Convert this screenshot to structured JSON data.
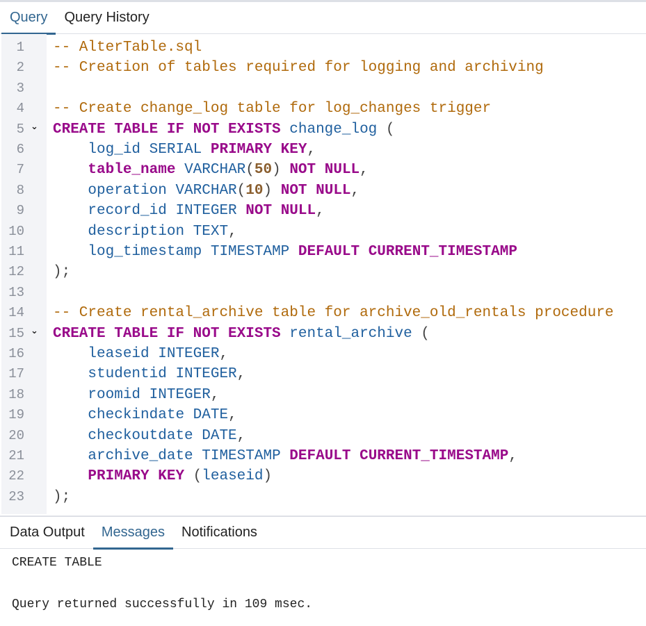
{
  "top_tabs": [
    {
      "label": "Query",
      "active": true
    },
    {
      "label": "Query History",
      "active": false
    }
  ],
  "editor": {
    "fold_lines": [
      5,
      15
    ],
    "lines": [
      [
        [
          "c",
          "-- AlterTable.sql"
        ]
      ],
      [
        [
          "c",
          "-- Creation of tables required for logging and archiving"
        ]
      ],
      [],
      [
        [
          "c",
          "-- Create change_log table for log_changes trigger"
        ]
      ],
      [
        [
          "k",
          "CREATE TABLE IF NOT EXISTS"
        ],
        [
          "p",
          " "
        ],
        [
          "i",
          "change_log"
        ],
        [
          "p",
          " ("
        ]
      ],
      [
        [
          "p",
          "    "
        ],
        [
          "i",
          "log_id SERIAL"
        ],
        [
          "p",
          " "
        ],
        [
          "k",
          "PRIMARY KEY"
        ],
        [
          "p",
          ","
        ]
      ],
      [
        [
          "p",
          "    "
        ],
        [
          "b",
          "table_name"
        ],
        [
          "p",
          " "
        ],
        [
          "i",
          "VARCHAR"
        ],
        [
          "p",
          "("
        ],
        [
          "n",
          "50"
        ],
        [
          "p",
          ") "
        ],
        [
          "k",
          "NOT NULL"
        ],
        [
          "p",
          ","
        ]
      ],
      [
        [
          "p",
          "    "
        ],
        [
          "i",
          "operation VARCHAR"
        ],
        [
          "p",
          "("
        ],
        [
          "n",
          "10"
        ],
        [
          "p",
          ") "
        ],
        [
          "k",
          "NOT NULL"
        ],
        [
          "p",
          ","
        ]
      ],
      [
        [
          "p",
          "    "
        ],
        [
          "i",
          "record_id INTEGER"
        ],
        [
          "p",
          " "
        ],
        [
          "k",
          "NOT NULL"
        ],
        [
          "p",
          ","
        ]
      ],
      [
        [
          "p",
          "    "
        ],
        [
          "i",
          "description TEXT"
        ],
        [
          "p",
          ","
        ]
      ],
      [
        [
          "p",
          "    "
        ],
        [
          "i",
          "log_timestamp TIMESTAMP"
        ],
        [
          "p",
          " "
        ],
        [
          "k",
          "DEFAULT CURRENT_TIMESTAMP"
        ]
      ],
      [
        [
          "p",
          ");"
        ]
      ],
      [],
      [
        [
          "c",
          "-- Create rental_archive table for archive_old_rentals procedure"
        ]
      ],
      [
        [
          "k",
          "CREATE TABLE IF NOT EXISTS"
        ],
        [
          "p",
          " "
        ],
        [
          "i",
          "rental_archive"
        ],
        [
          "p",
          " ("
        ]
      ],
      [
        [
          "p",
          "    "
        ],
        [
          "i",
          "leaseid INTEGER"
        ],
        [
          "p",
          ","
        ]
      ],
      [
        [
          "p",
          "    "
        ],
        [
          "i",
          "studentid INTEGER"
        ],
        [
          "p",
          ","
        ]
      ],
      [
        [
          "p",
          "    "
        ],
        [
          "i",
          "roomid INTEGER"
        ],
        [
          "p",
          ","
        ]
      ],
      [
        [
          "p",
          "    "
        ],
        [
          "i",
          "checkindate DATE"
        ],
        [
          "p",
          ","
        ]
      ],
      [
        [
          "p",
          "    "
        ],
        [
          "i",
          "checkoutdate DATE"
        ],
        [
          "p",
          ","
        ]
      ],
      [
        [
          "p",
          "    "
        ],
        [
          "i",
          "archive_date TIMESTAMP"
        ],
        [
          "p",
          " "
        ],
        [
          "k",
          "DEFAULT CURRENT_TIMESTAMP"
        ],
        [
          "p",
          ","
        ]
      ],
      [
        [
          "p",
          "    "
        ],
        [
          "k",
          "PRIMARY KEY"
        ],
        [
          "p",
          " ("
        ],
        [
          "i",
          "leaseid"
        ],
        [
          "p",
          ")"
        ]
      ],
      [
        [
          "p",
          ");"
        ]
      ]
    ]
  },
  "bottom_tabs": [
    {
      "label": "Data Output",
      "active": false
    },
    {
      "label": "Messages",
      "active": true
    },
    {
      "label": "Notifications",
      "active": false
    }
  ],
  "messages": [
    "CREATE TABLE",
    "Query returned successfully in 109 msec."
  ],
  "colors": {
    "accent": "#326690",
    "comment": "#b06a0c",
    "keyword": "#990a8a",
    "identifier": "#1f5f9e",
    "number": "#8a5e2e"
  }
}
